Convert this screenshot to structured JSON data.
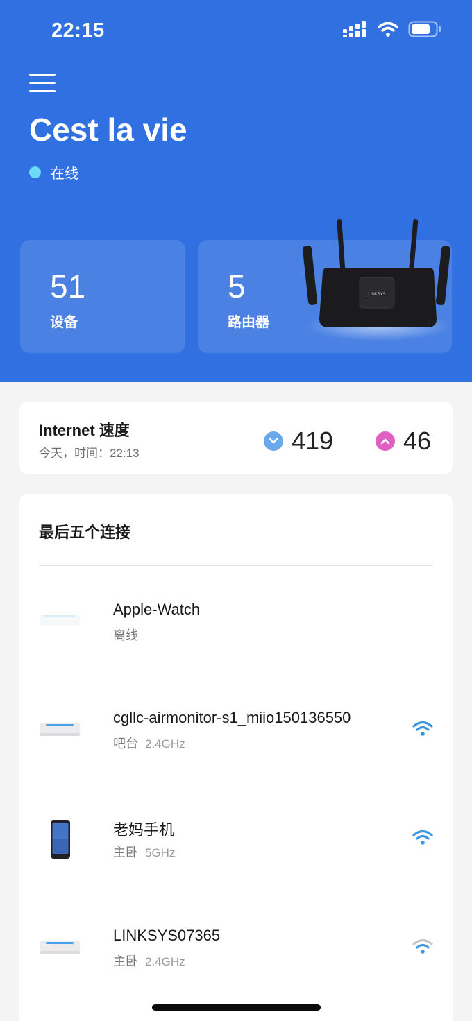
{
  "status_bar": {
    "time": "22:15"
  },
  "header": {
    "network_name": "Cest la vie",
    "status_text": "在线",
    "status_color": "#6cdaf8",
    "background_color": "#3170e0"
  },
  "stats": {
    "devices": {
      "count": "51",
      "label": "设备"
    },
    "routers": {
      "count": "5",
      "label": "路由器"
    }
  },
  "router_logo": "LINKSYS",
  "speed": {
    "title": "Internet 速度",
    "subtitle": "今天，时间：22:13",
    "download": "419",
    "upload": "46",
    "download_color": "#6aa8ec",
    "upload_color": "#e05fc3"
  },
  "recent": {
    "title": "最后五个连接",
    "devices": [
      {
        "name": "Apple-Watch",
        "location": "离线",
        "band": "",
        "icon": "puck-device-icon",
        "wifi": "none"
      },
      {
        "name": "cgllc-airmonitor-s1_miio150136550",
        "location": "吧台",
        "band": "2.4GHz",
        "icon": "puck-device-icon",
        "wifi": "strong"
      },
      {
        "name": "老妈手机",
        "location": "主卧",
        "band": "5GHz",
        "icon": "phone-icon",
        "wifi": "strong"
      },
      {
        "name": "LINKSYS07365",
        "location": "主卧",
        "band": "2.4GHz",
        "icon": "puck-device-icon",
        "wifi": "weak"
      }
    ]
  }
}
